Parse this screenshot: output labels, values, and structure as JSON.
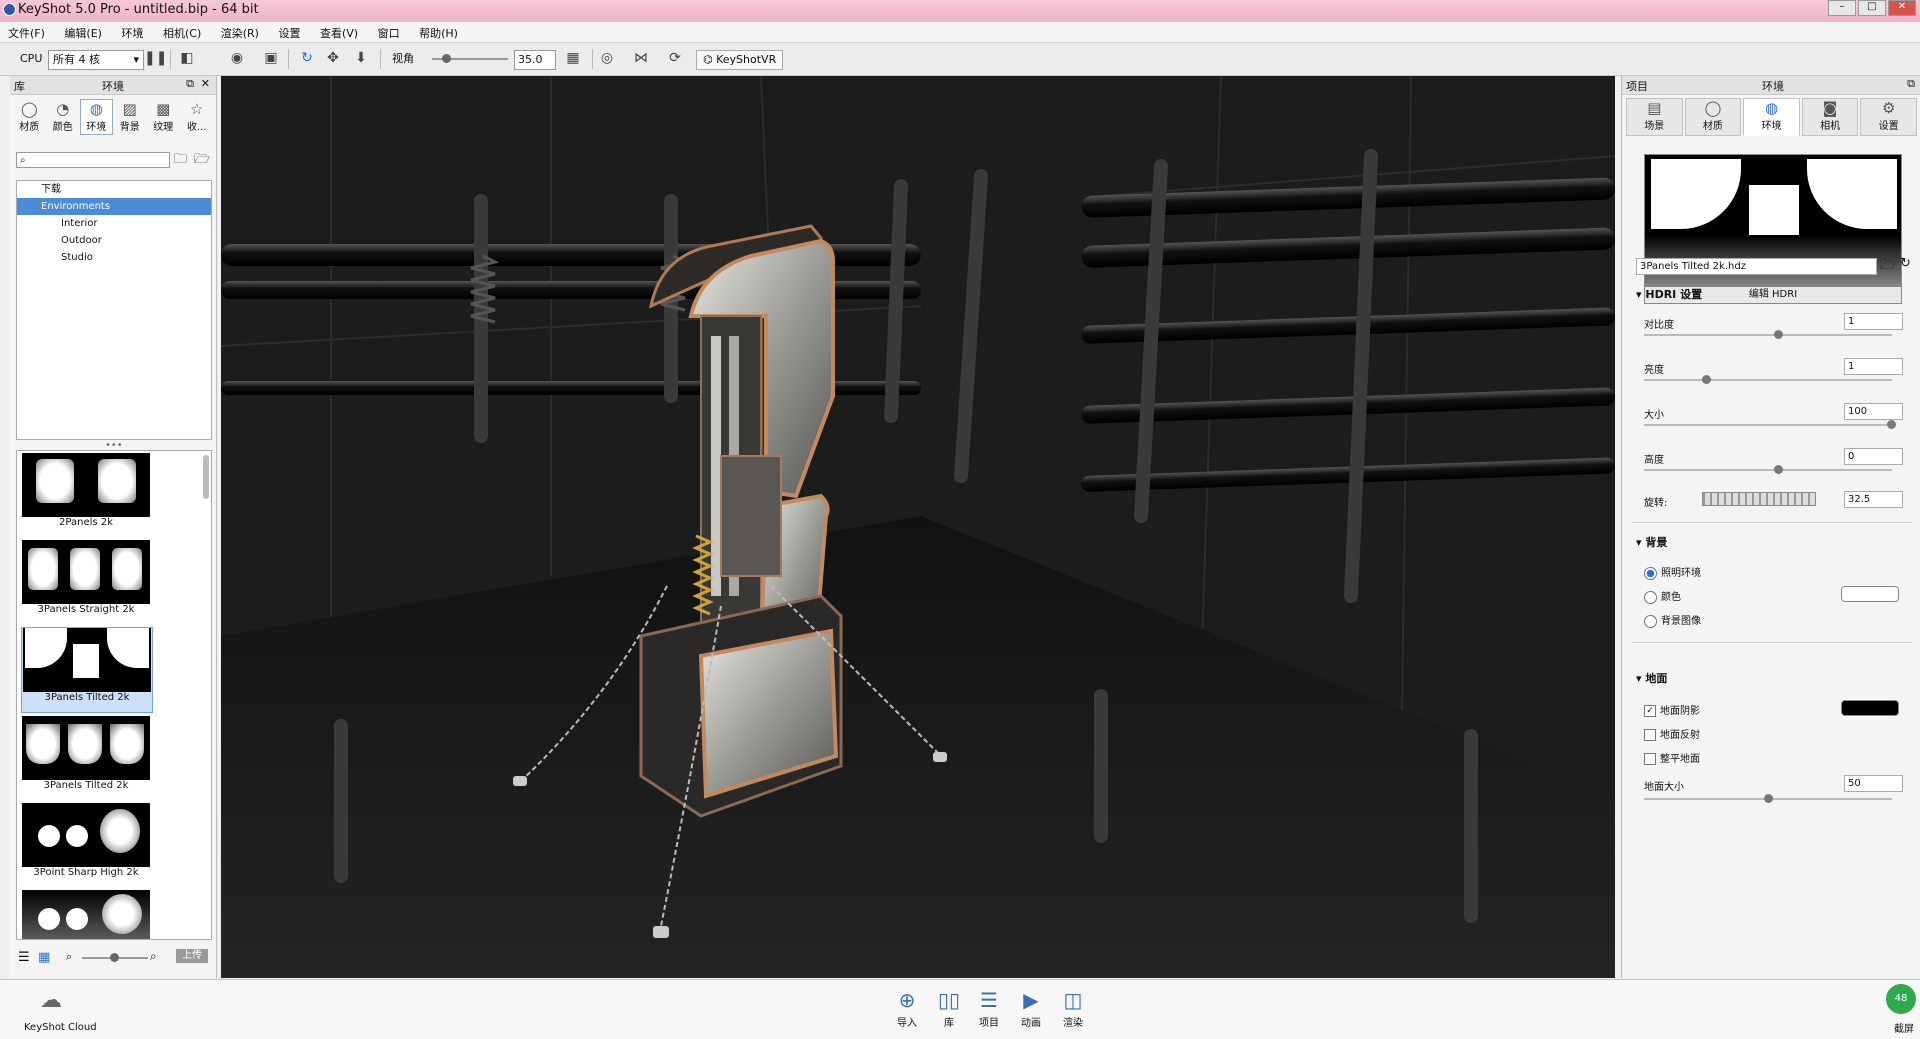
{
  "window": {
    "title": "KeyShot 5.0 Pro  - untitled.bip  - 64 bit"
  },
  "menu": [
    "文件(F)",
    "编辑(E)",
    "环境",
    "相机(C)",
    "渲染(R)",
    "设置",
    "查看(V)",
    "窗口",
    "帮助(H)"
  ],
  "toolbar": {
    "cpu_label": "CPU",
    "cpu_value": "所有 4 核",
    "fov_label": "视角",
    "fov_value": "35.0",
    "vr_label": "KeyShotVR"
  },
  "library": {
    "header": "库",
    "title": "环境",
    "tabs": [
      {
        "label": "材质",
        "icon": "material-icon"
      },
      {
        "label": "颜色",
        "icon": "color-icon"
      },
      {
        "label": "环境",
        "icon": "globe-icon"
      },
      {
        "label": "背景",
        "icon": "image-icon"
      },
      {
        "label": "纹理",
        "icon": "texture-icon"
      },
      {
        "label": "收...",
        "icon": "star-icon"
      }
    ],
    "active_tab": "环境",
    "tree": [
      {
        "label": "下载",
        "indent": 0,
        "selected": false
      },
      {
        "label": "Environments",
        "indent": 0,
        "selected": true
      },
      {
        "label": "Interior",
        "indent": 1,
        "selected": false
      },
      {
        "label": "Outdoor",
        "indent": 1,
        "selected": false
      },
      {
        "label": "Studio",
        "indent": 1,
        "selected": false
      }
    ],
    "thumbnails": [
      {
        "label": "2Panels 2k",
        "selected": false
      },
      {
        "label": "3Panels Straight 2k",
        "selected": false
      },
      {
        "label": "3Panels Tilted 2k",
        "selected": true
      },
      {
        "label": "3Panels Tilted 2k",
        "selected": false
      },
      {
        "label": "3Point Sharp High 2k",
        "selected": false
      },
      {
        "label": "",
        "selected": false
      }
    ],
    "upload_label": "上传"
  },
  "project": {
    "header": "项目",
    "title": "环境",
    "tabs": [
      {
        "label": "场景",
        "icon": "scene-icon"
      },
      {
        "label": "材质",
        "icon": "material-icon"
      },
      {
        "label": "环境",
        "icon": "globe-icon"
      },
      {
        "label": "相机",
        "icon": "camera-icon"
      },
      {
        "label": "设置",
        "icon": "gear-icon"
      }
    ],
    "active_tab": "环境",
    "hdri_edit_label": "编辑 HDRI",
    "hdri_file": "3Panels Tilted 2k.hdz",
    "hdri_section": "HDRI 设置",
    "contrast_label": "对比度",
    "contrast": "1",
    "brightness_label": "亮度",
    "brightness": "1",
    "size_label": "大小",
    "size": "100",
    "height_label": "高度",
    "height": "0",
    "rotation_label": "旋转:",
    "rotation": "32.5",
    "background_section": "背景",
    "bg_options": [
      {
        "label": "照明环境",
        "checked": true
      },
      {
        "label": "颜色",
        "checked": false
      },
      {
        "label": "背景图像",
        "checked": false
      }
    ],
    "ground_section": "地面",
    "ground_options": [
      {
        "label": "地面阴影",
        "checked": true
      },
      {
        "label": "地面反射",
        "checked": false
      },
      {
        "label": "整平地面",
        "checked": false
      }
    ],
    "ground_size_label": "地面大小",
    "ground_size": "50",
    "bg_color": "#ffffff",
    "shadow_color": "#000000"
  },
  "bottom": {
    "cloud_label": "KeyShot Cloud",
    "buttons": [
      "导入",
      "库",
      "项目",
      "动画",
      "渲染"
    ],
    "screenshot_label": "截屏",
    "badge": "48"
  }
}
